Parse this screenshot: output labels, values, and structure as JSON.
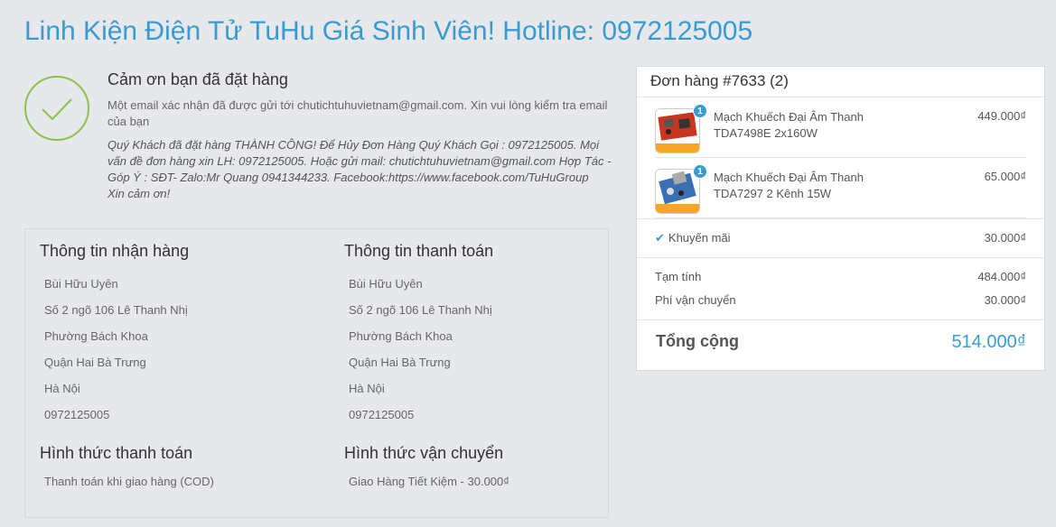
{
  "header": {
    "title": "Linh Kiện Điện Tử TuHu Giá Sinh Viên! Hotline: 0972125005"
  },
  "thanks": {
    "title": "Cảm ơn bạn đã đặt hàng",
    "email_msg": "Một email xác nhận đã được gửi tới chutichtuhuvietnam@gmail.com. Xin vui lòng kiểm tra email của bạn",
    "note_1": "Quý Khách đã đặt hàng THÀNH CÔNG! Để Hủy Đơn Hàng Quý Khách Gọi : 0972125005. Mọi vấn đề đơn hàng xin LH: 0972125005. Hoặc gửi mail: chutichtuhuvietnam@gmail.com Hợp Tác - Góp Ý : SĐT- Zalo:Mr Quang 0941344233. Facebook:https://www.facebook.com/TuHuGroup",
    "note_2": "Xin cảm ơn!"
  },
  "shipping_info": {
    "title": "Thông tin nhận hàng",
    "lines": [
      "Bùi Hữu Uyên",
      "Số 2 ngõ 106 Lê Thanh Nhị",
      "Phường Bách Khoa",
      "Quận Hai Bà Trưng",
      "Hà Nội",
      "0972125005"
    ]
  },
  "billing_info": {
    "title": "Thông tin thanh toán",
    "lines": [
      "Bùi Hữu Uyên",
      "Số 2 ngõ 106 Lê Thanh Nhị",
      "Phường Bách Khoa",
      "Quận Hai Bà Trưng",
      "Hà Nội",
      "0972125005"
    ]
  },
  "payment_method": {
    "title": "Hình thức thanh toán",
    "value": "Thanh toán khi giao hàng (COD)"
  },
  "shipping_method": {
    "title": "Hình thức vận chuyển",
    "value": "Giao Hàng Tiết Kiệm - 30.000₫"
  },
  "order": {
    "title": "Đơn hàng #7633 (2)",
    "items": [
      {
        "name": "Mạch Khuếch Đại Âm Thanh TDA7498E 2x160W",
        "qty": "1",
        "price": "449.000₫",
        "thumb_icon": "red-amplifier-board-icon"
      },
      {
        "name": "Mạch Khuếch Đại Âm Thanh TDA7297 2 Kênh 15W",
        "qty": "1",
        "price": "65.000₫",
        "thumb_icon": "amplifier-module-icon"
      }
    ],
    "promo_label": "Khuyến mãi",
    "promo_value": "30.000₫",
    "subtotal_label": "Tạm tính",
    "subtotal_value": "484.000₫",
    "ship_label": "Phí vận chuyển",
    "ship_value": "30.000₫",
    "total_label": "Tổng cộng",
    "total_value": "514.000₫"
  },
  "colors": {
    "accent": "#3a9bd1",
    "success": "#8bc34a",
    "background": "#e6e8eb"
  }
}
